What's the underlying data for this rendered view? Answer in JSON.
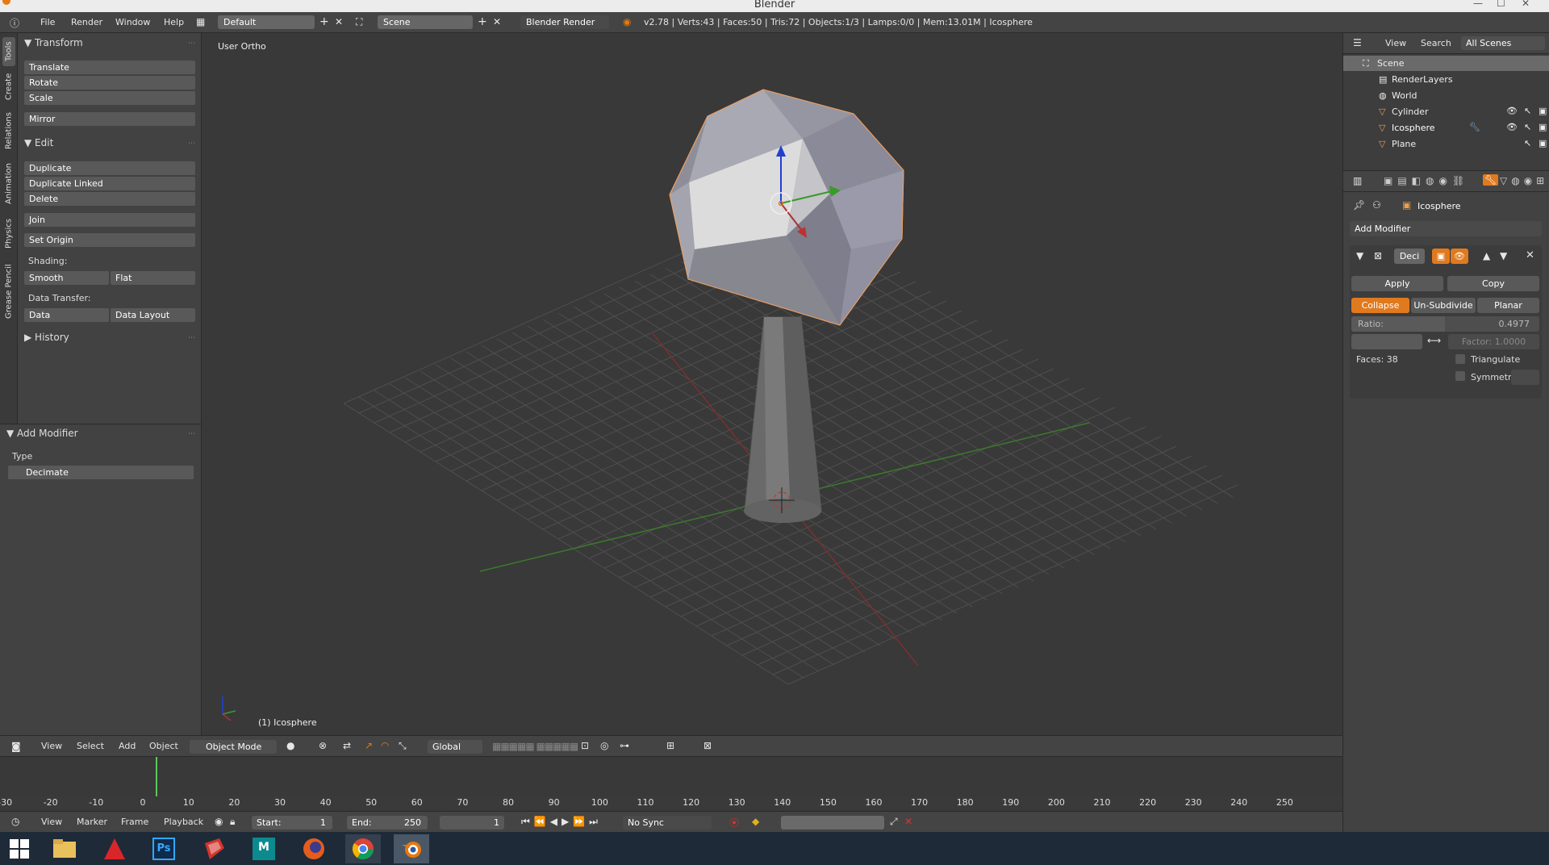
{
  "app": {
    "window_title": "Blender"
  },
  "menu": {
    "file": "File",
    "render": "Render",
    "window": "Window",
    "help": "Help"
  },
  "topbar": {
    "screen_layout": "Default",
    "scene": "Scene",
    "render_engine": "Blender Render",
    "stats": "v2.78 | Verts:43 | Faces:50 | Tris:72 | Objects:1/3 | Lamps:0/0 | Mem:13.01M | Icosphere"
  },
  "tool_tabs": [
    "Tools",
    "Create",
    "Relations",
    "Animation",
    "Physics",
    "Grease Pencil"
  ],
  "tools": {
    "transform": {
      "title": "Transform",
      "translate": "Translate",
      "rotate": "Rotate",
      "scale": "Scale",
      "mirror": "Mirror"
    },
    "edit": {
      "title": "Edit",
      "duplicate": "Duplicate",
      "duplicate_linked": "Duplicate Linked",
      "delete": "Delete",
      "join": "Join",
      "set_origin": "Set Origin",
      "shading_label": "Shading:",
      "smooth": "Smooth",
      "flat": "Flat",
      "data_transfer_label": "Data Transfer:",
      "data": "Data",
      "data_layout": "Data Layout"
    },
    "history": {
      "title": "History"
    }
  },
  "redo_panel": {
    "title": "Add Modifier",
    "type_label": "Type",
    "type_value": "Decimate"
  },
  "viewport": {
    "view_name": "User Ortho",
    "active_object": "(1) Icosphere"
  },
  "view3d_header": {
    "view": "View",
    "select": "Select",
    "add": "Add",
    "object": "Object",
    "mode": "Object Mode",
    "orientation": "Global"
  },
  "timeline": {
    "ticks": [
      "-30",
      "-20",
      "-10",
      "0",
      "10",
      "20",
      "30",
      "40",
      "50",
      "60",
      "70",
      "80",
      "90",
      "100",
      "110",
      "120",
      "130",
      "140",
      "150",
      "160",
      "170",
      "180",
      "190",
      "200",
      "210",
      "220",
      "230",
      "240",
      "250"
    ],
    "current_frame": 0
  },
  "timeline_header": {
    "view": "View",
    "marker": "Marker",
    "frame": "Frame",
    "playback": "Playback",
    "start_label": "Start:",
    "start_value": "1",
    "end_label": "End:",
    "end_value": "250",
    "current": "1",
    "sync": "No Sync"
  },
  "outliner": {
    "view": "View",
    "search": "Search",
    "filter": "All Scenes",
    "items": [
      {
        "name": "Scene",
        "level": 0
      },
      {
        "name": "RenderLayers",
        "level": 1
      },
      {
        "name": "World",
        "level": 1
      },
      {
        "name": "Cylinder",
        "level": 1
      },
      {
        "name": "Icosphere",
        "level": 1
      },
      {
        "name": "Plane",
        "level": 1
      }
    ]
  },
  "properties": {
    "object_name": "Icosphere",
    "add_modifier": "Add Modifier",
    "modifier_name": "Deci",
    "apply": "Apply",
    "copy": "Copy",
    "mode_tabs": [
      "Collapse",
      "Un-Subdivide",
      "Planar"
    ],
    "ratio_label": "Ratio:",
    "ratio_value": "0.4977",
    "factor": "Factor: 1.0000",
    "faces": "Faces: 38",
    "triangulate": "Triangulate",
    "symmetry": "Symmetr"
  },
  "colors": {
    "accent": "#e07a1f",
    "selection": "#f5a25a",
    "x_axis": "#b03030",
    "y_axis": "#3a9a2a",
    "z_axis": "#2040d0"
  }
}
